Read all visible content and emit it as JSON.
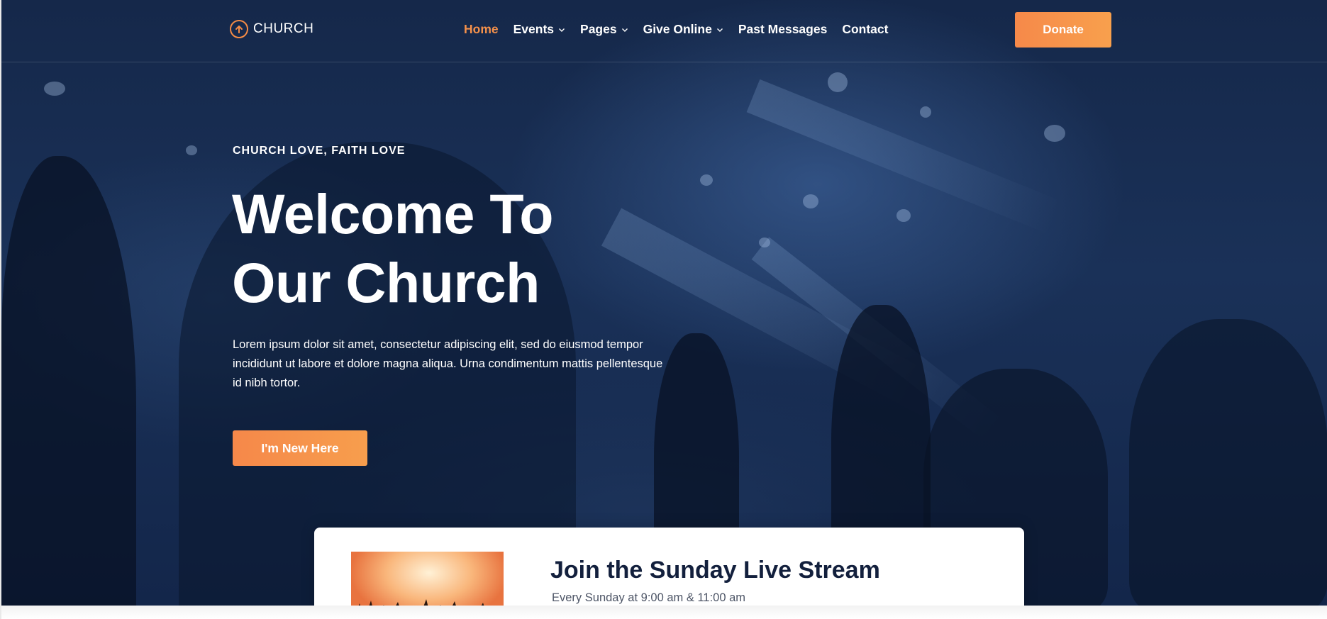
{
  "header": {
    "logo": {
      "icon": "arrow-up-circle-icon",
      "text": "CHURCH"
    },
    "nav": [
      {
        "label": "Home",
        "active": true,
        "dropdown": false
      },
      {
        "label": "Events",
        "active": false,
        "dropdown": true
      },
      {
        "label": "Pages",
        "active": false,
        "dropdown": true
      },
      {
        "label": "Give Online",
        "active": false,
        "dropdown": true
      },
      {
        "label": "Past Messages",
        "active": false,
        "dropdown": false
      },
      {
        "label": "Contact",
        "active": false,
        "dropdown": false
      }
    ],
    "donate_label": "Donate"
  },
  "hero": {
    "eyebrow": "CHURCH LOVE, FAITH LOVE",
    "title_line1": "Welcome To",
    "title_line2": "Our Church",
    "lead": "Lorem ipsum dolor sit amet, consectetur adipiscing elit, sed do eiusmod tempor incididunt ut labore et dolore magna aliqua. Urna condimentum mattis pellentesque id nibh tortor.",
    "cta_label": "I'm New Here"
  },
  "livestream": {
    "title": "Join the Sunday Live Stream",
    "subtitle": "Every Sunday at 9:00 am & 11:00 am"
  },
  "colors": {
    "accent": "#f5914b",
    "hero_bg": "#1a3158",
    "card_title": "#13203d"
  }
}
